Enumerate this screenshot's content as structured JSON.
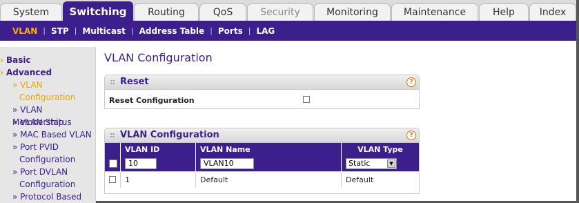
{
  "top_tabs": [
    {
      "label": "System"
    },
    {
      "label": "Switching"
    },
    {
      "label": "Routing"
    },
    {
      "label": "QoS"
    },
    {
      "label": "Security"
    },
    {
      "label": "Monitoring"
    },
    {
      "label": "Maintenance"
    },
    {
      "label": "Help"
    },
    {
      "label": "Index"
    }
  ],
  "sub_nav": [
    "VLAN",
    "STP",
    "Multicast",
    "Address Table",
    "Ports",
    "LAG"
  ],
  "sidebar": {
    "basic": "Basic",
    "advanced": "Advanced",
    "items": [
      {
        "line1": "» VLAN",
        "line2": "Configuration"
      },
      {
        "line1": "» VLAN Membership"
      },
      {
        "line1": "» VLAN Status"
      },
      {
        "line1": "» MAC Based VLAN"
      },
      {
        "line1": "» Port PVID",
        "line2": "Configuration"
      },
      {
        "line1": "» Port DVLAN",
        "line2": "Configuration"
      },
      {
        "line1": "» Protocol Based"
      }
    ]
  },
  "page_title": "VLAN Configuration",
  "reset_panel": {
    "title": "Reset",
    "row_label": "Reset Configuration"
  },
  "vlan_panel": {
    "title": "VLAN Configuration",
    "columns": [
      "VLAN ID",
      "VLAN Name",
      "VLAN Type"
    ],
    "edit_row": {
      "vlan_id": "10",
      "vlan_name": "VLAN10",
      "vlan_type": "Static"
    },
    "rows": [
      {
        "vlan_id": "1",
        "vlan_name": "Default",
        "vlan_type": "Default"
      }
    ]
  },
  "help_glyph": "?",
  "colors": {
    "brand": "#3c1e8c",
    "accent": "#ffb000"
  }
}
